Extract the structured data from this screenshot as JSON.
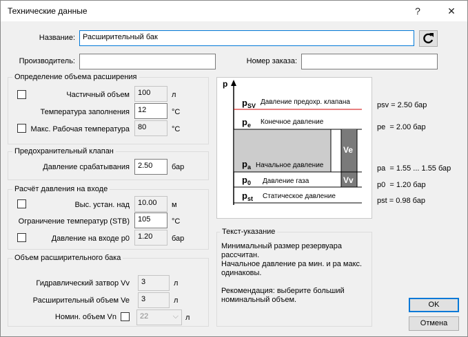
{
  "window": {
    "title": "Технические данные",
    "help": "?",
    "close": "✕"
  },
  "header": {
    "name_label": "Название:",
    "name_value": "Расширительный бак",
    "manufacturer_label": "Производитель:",
    "manufacturer_value": "",
    "order_label": "Номер заказа:",
    "order_value": ""
  },
  "expansion": {
    "title": "Определение объема расширения",
    "partial_label": "Частичный объем",
    "partial_value": "100",
    "partial_unit": "л",
    "fill_temp_label": "Температура заполнения",
    "fill_temp_value": "12",
    "fill_temp_unit": "°C",
    "max_temp_label": "Макс. Рабочая температура",
    "max_temp_value": "80",
    "max_temp_unit": "°C"
  },
  "safety": {
    "title": "Предохранительный клапан",
    "trigger_label": "Давление срабатывания",
    "trigger_value": "2.50",
    "trigger_unit": "бар"
  },
  "inlet": {
    "title": "Расчёт давления на входе",
    "height_label": "Выс. устан. над",
    "height_value": "10.00",
    "height_unit": "м",
    "stb_label": "Ограничение температур (STB)",
    "stb_value": "105",
    "stb_unit": "°C",
    "p0_label": "Давление на входе p0",
    "p0_value": "1.20",
    "p0_unit": "бар"
  },
  "tank": {
    "title": "Объем расширительного бака",
    "vv_label": "Гидравлический затвор Vv",
    "vv_value": "3",
    "vv_unit": "л",
    "ve_label": "Расширительный объем Ve",
    "ve_value": "3",
    "ve_unit": "л",
    "vn_label": "Номин. объем Vn",
    "vn_value": "22",
    "vn_unit": "л"
  },
  "diagram": {
    "axis": "p",
    "rows": [
      {
        "sym": "p",
        "sub": "SV",
        "text": "Давление предохр. клапана"
      },
      {
        "sym": "p",
        "sub": "e",
        "text": "Конечное давление"
      },
      {
        "sym": "p",
        "sub": "a",
        "text": "Начальное давление"
      },
      {
        "sym": "p",
        "sub": "0",
        "text": "Давление газа"
      },
      {
        "sym": "p",
        "sub": "st",
        "text": "Статическое давление"
      }
    ],
    "ve": "Ve",
    "vv": "Vv",
    "readouts": {
      "psv": "psv = 2.50 бар",
      "pe": "pe  = 2.00 бар",
      "pa": "pa  = 1.55 ... 1.55 бар",
      "p0": "p0  = 1.20 бар",
      "pst": "pst = 0.98 бар"
    }
  },
  "note": {
    "title": "Текст-указание",
    "line1": "Минимальный размер резервуара",
    "line2": "рассчитан.",
    "line3": "Начальное давление pa мин. и pa макс.",
    "line4": "одинаковы.",
    "line5": "Рекомендация: выберите больший",
    "line6": "номинальный объем."
  },
  "buttons": {
    "ok": "OK",
    "cancel": "Отмена"
  },
  "colors": {
    "psv_line": "#d00000",
    "gas_fill": "#cccccc",
    "side_fill": "#7a7a7a",
    "focus_border": "#0078d7"
  }
}
